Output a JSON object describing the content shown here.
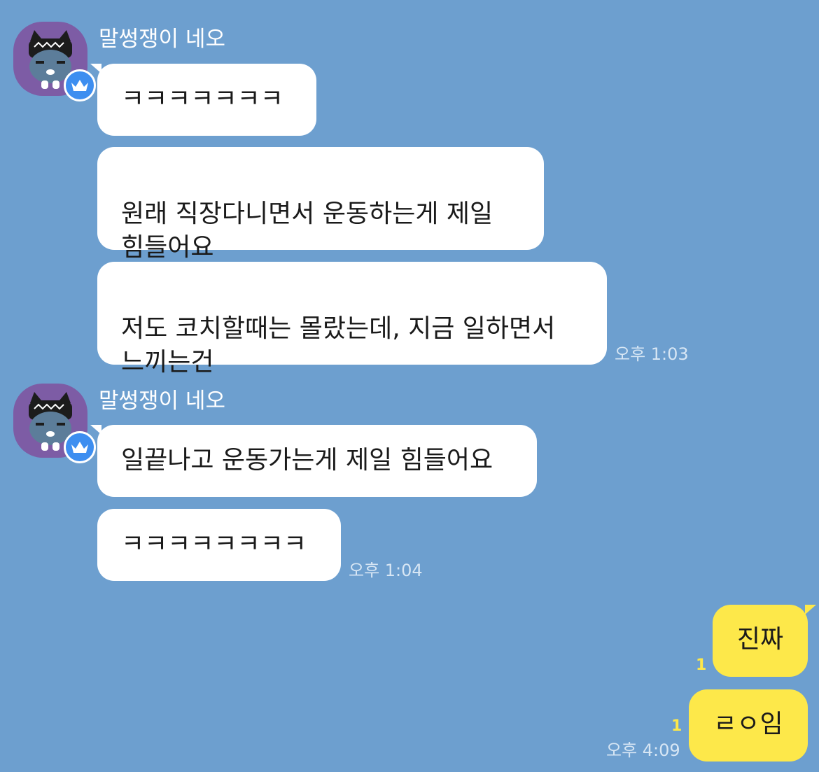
{
  "chat": {
    "groups": [
      {
        "sender": "말썽쟁이 네오",
        "messages": [
          "ㅋㅋㅋㅋㅋㅋㅋ",
          "원래 직장다니면서 운동하는게 제일\n힘들어요",
          "저도 코치할때는 몰랐는데, 지금 일하면서\n느끼는건"
        ],
        "time": "오후 1:03"
      },
      {
        "sender": "말썽쟁이 네오",
        "messages": [
          "일끝나고 운동가는게 제일 힘들어요",
          "ㅋㅋㅋㅋㅋㅋㅋㅋ"
        ],
        "time": "오후 1:04"
      }
    ],
    "mine": {
      "messages": [
        {
          "text": "진짜",
          "unread": "1"
        },
        {
          "text": "ㄹㅇ임",
          "unread": "1"
        }
      ],
      "time": "오후 4:09"
    }
  },
  "colors": {
    "background": "#6d9fcf",
    "my_bubble": "#fde84a",
    "their_bubble": "#ffffff",
    "avatar_bg": "#7d5ca5",
    "badge": "#3d8ef0"
  },
  "icons": {
    "avatar": "neo-character-avatar",
    "badge": "crown-icon"
  }
}
